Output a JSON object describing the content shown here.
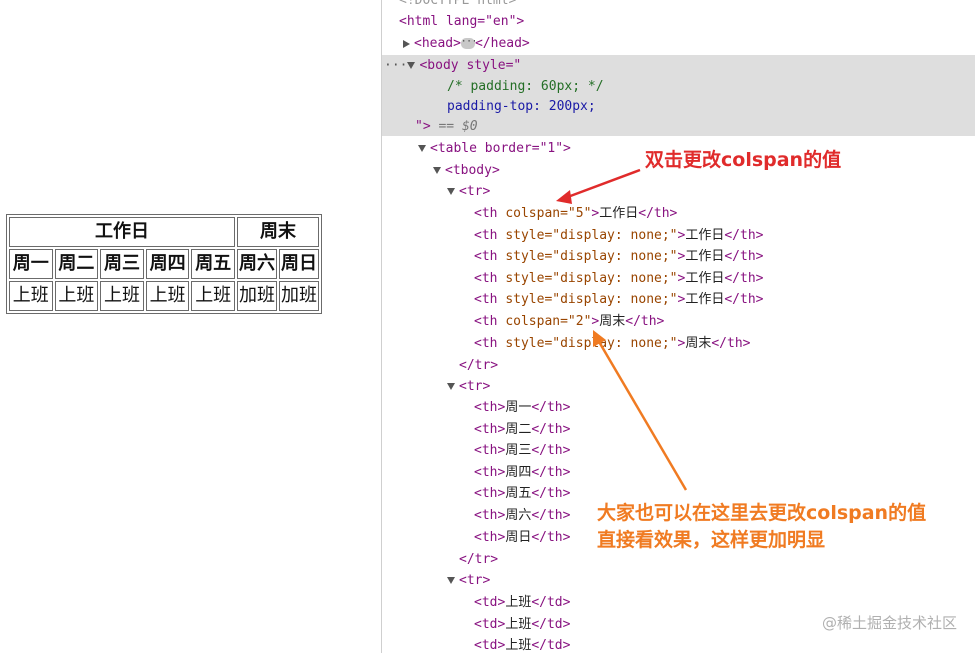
{
  "demo_table": {
    "header": [
      {
        "text": "工作日",
        "colspan": 5
      },
      {
        "text": "周末",
        "colspan": 2
      }
    ],
    "days": [
      "周一",
      "周二",
      "周三",
      "周四",
      "周五",
      "周六",
      "周日"
    ],
    "status": [
      "上班",
      "上班",
      "上班",
      "上班",
      "上班",
      "加班",
      "加班"
    ]
  },
  "devtools": {
    "doctype": "<!DOCTYPE html>",
    "html_open": "<html lang=\"en\">",
    "head": "<head>",
    "head_close": "</head>",
    "body_open": "<body style=\"",
    "body_comment": "/* padding: 60px; */",
    "body_padding": "padding-top: 200px;",
    "body_end": "\">",
    "body_eq": "== $0",
    "table_open": "<table border=\"1\">",
    "tbody_open": "<tbody>",
    "tr_open": "<tr>",
    "tr_close": "</tr>",
    "row1": [
      {
        "attr": "colspan=\"5\"",
        "text": "工作日"
      },
      {
        "attr": "style=\"display: none;\"",
        "text": "工作日"
      },
      {
        "attr": "style=\"display: none;\"",
        "text": "工作日"
      },
      {
        "attr": "style=\"display: none;\"",
        "text": "工作日"
      },
      {
        "attr": "style=\"display: none;\"",
        "text": "工作日"
      },
      {
        "attr": "colspan=\"2\"",
        "text": "周末"
      },
      {
        "attr": "style=\"display: none;\"",
        "text": "周末"
      }
    ],
    "row2": [
      "周一",
      "周二",
      "周三",
      "周四",
      "周五",
      "周六",
      "周日"
    ],
    "row3": [
      "上班",
      "上班",
      "上班"
    ]
  },
  "annotations": {
    "top": "双击更改colspan的值",
    "bottom_line1": "大家也可以在这里去更改colspan的值",
    "bottom_line2": "直接看效果，这样更加明显"
  },
  "watermark": "@稀土掘金技术社区",
  "colors": {
    "red_annotation": "#e02b2b",
    "orange_annotation": "#f07b22",
    "selection": "#dedede"
  }
}
